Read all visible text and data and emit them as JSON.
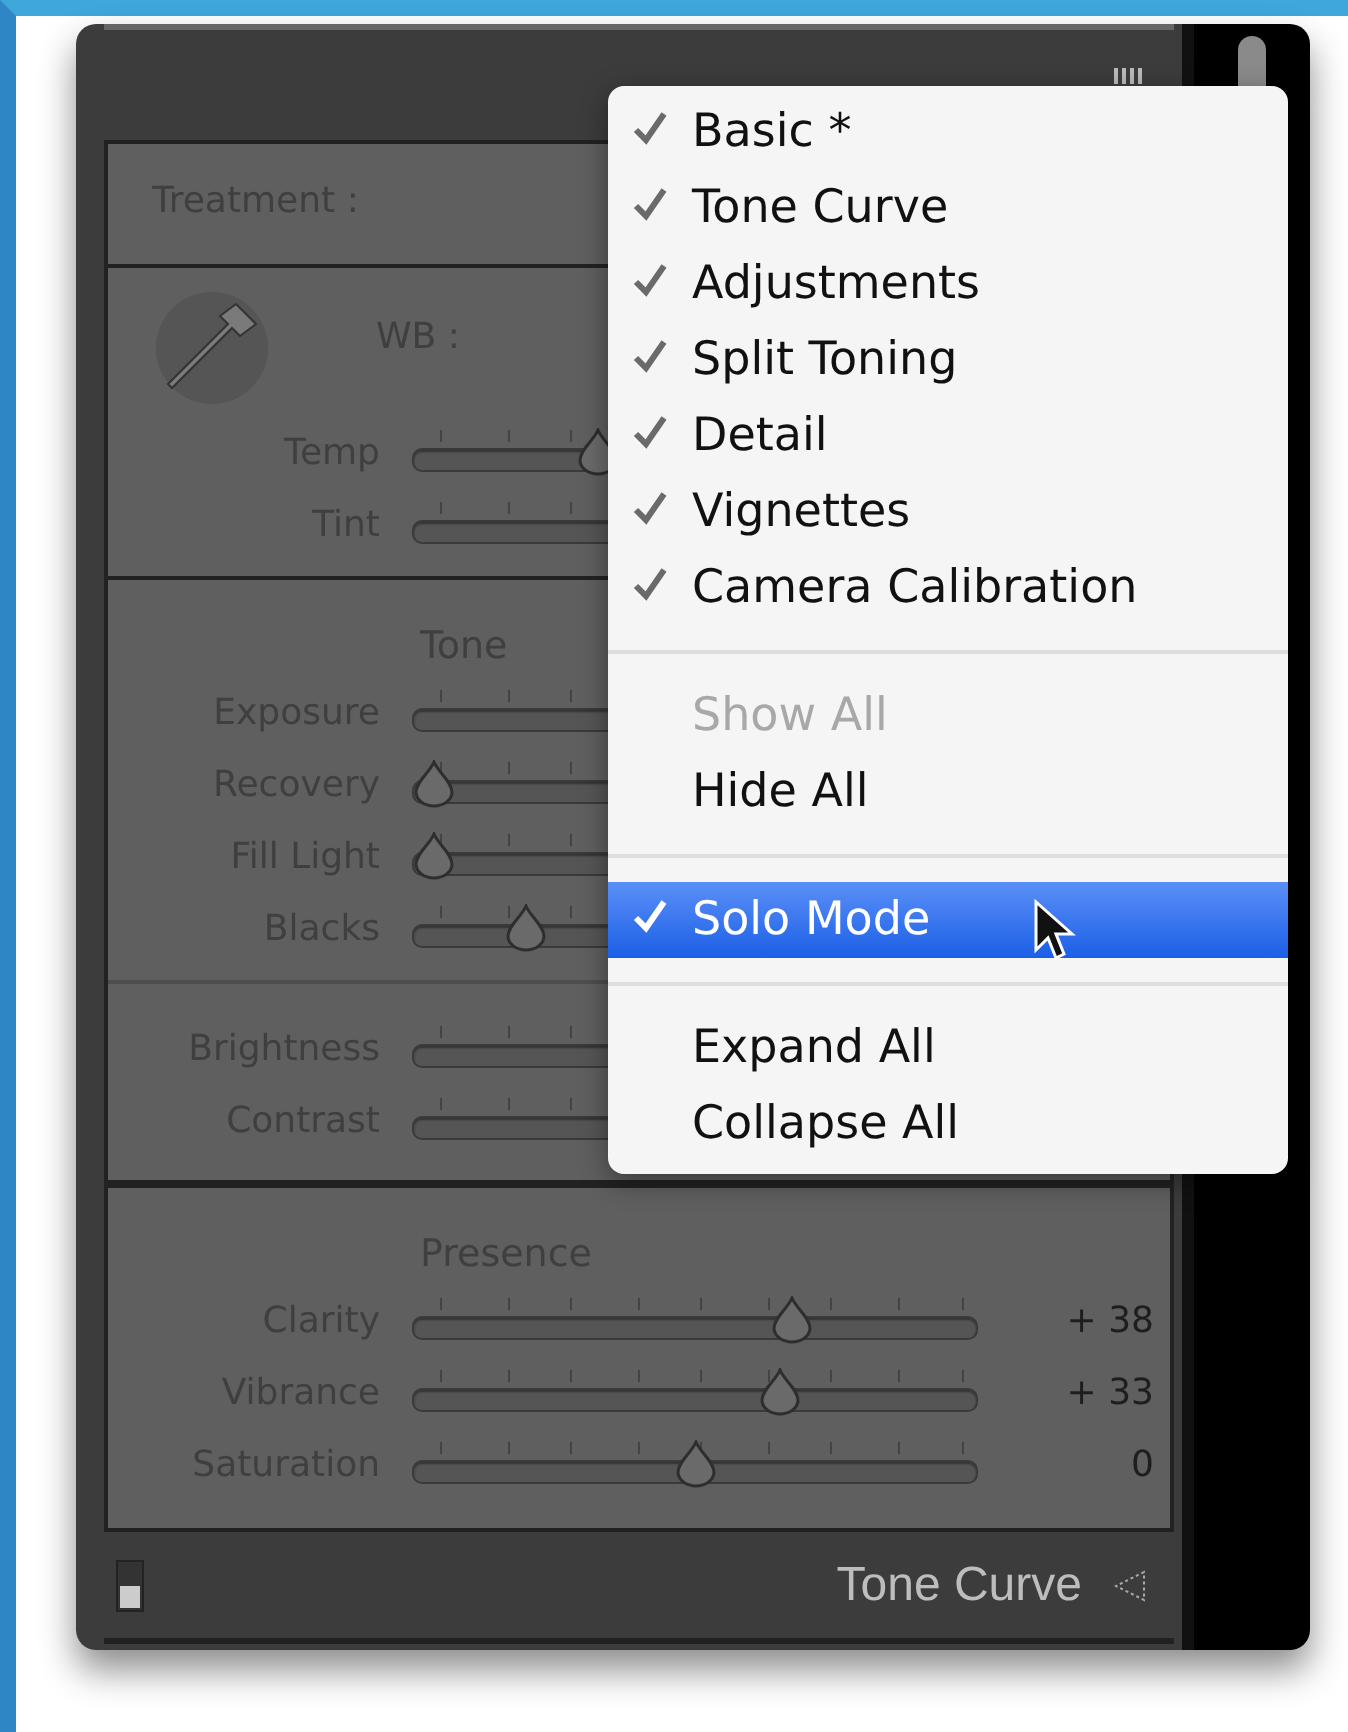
{
  "panel": {
    "treatment_label": "Treatment :",
    "wb_label": "WB :",
    "wb_sliders": [
      {
        "label": "Temp",
        "level": 0.33
      },
      {
        "label": "Tint"
      }
    ],
    "tone_heading": "Tone",
    "tone_sliders": [
      {
        "label": "Exposure"
      },
      {
        "label": "Recovery",
        "level": 0.04
      },
      {
        "label": "Fill Light",
        "level": 0.04
      },
      {
        "label": "Blacks",
        "level": 0.2
      }
    ],
    "tone_sliders_2": [
      {
        "label": "Brightness"
      },
      {
        "label": "Contrast"
      }
    ],
    "presence_heading": "Presence",
    "presence_sliders": [
      {
        "label": "Clarity",
        "level": 0.67,
        "reading": "+ 38"
      },
      {
        "label": "Vibrance",
        "level": 0.65,
        "reading": "+ 33"
      },
      {
        "label": "Saturation",
        "level": 0.5,
        "reading": "0"
      }
    ],
    "next_section": {
      "title": "Tone Curve"
    }
  },
  "menu": {
    "groups": [
      [
        {
          "label": "Basic *",
          "checked": true,
          "selected": false,
          "disabled": false
        },
        {
          "label": "Tone Curve",
          "checked": true,
          "selected": false,
          "disabled": false
        },
        {
          "label": "Adjustments",
          "checked": true,
          "selected": false,
          "disabled": false
        },
        {
          "label": "Split Toning",
          "checked": true,
          "selected": false,
          "disabled": false
        },
        {
          "label": "Detail",
          "checked": true,
          "selected": false,
          "disabled": false
        },
        {
          "label": "Vignettes",
          "checked": true,
          "selected": false,
          "disabled": false
        },
        {
          "label": "Camera Calibration",
          "checked": true,
          "selected": false,
          "disabled": false
        }
      ],
      [
        {
          "label": "Show All",
          "checked": false,
          "selected": false,
          "disabled": true
        },
        {
          "label": "Hide All",
          "checked": false,
          "selected": false,
          "disabled": false
        }
      ],
      [
        {
          "label": "Solo Mode",
          "checked": true,
          "selected": true,
          "disabled": false
        }
      ],
      [
        {
          "label": "Expand All",
          "checked": false,
          "selected": false,
          "disabled": false
        },
        {
          "label": "Collapse All",
          "checked": false,
          "selected": false,
          "disabled": false
        }
      ]
    ]
  }
}
